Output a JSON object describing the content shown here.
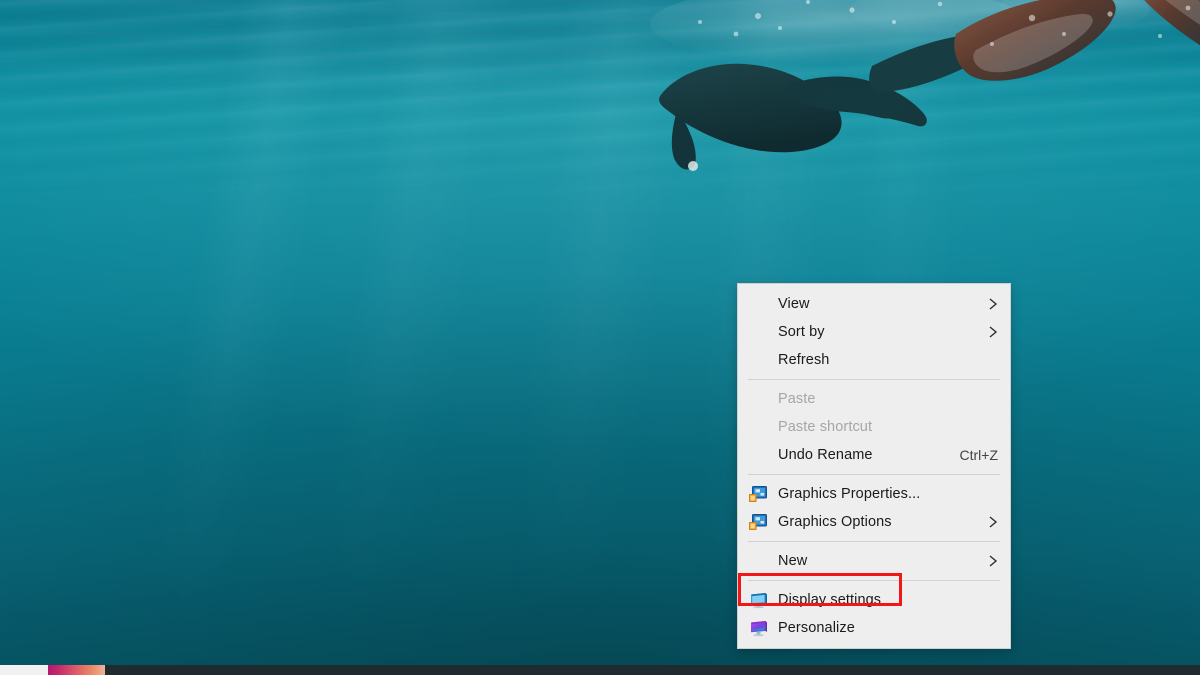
{
  "wallpaper": {
    "description": "underwater-scene-diver-with-fins",
    "water_color_top": "#0e93a4",
    "water_color_bottom": "#065968",
    "diver_color": "#173b3f"
  },
  "taskbar": {
    "background_color": "#1f2b2e",
    "search_box_color": "#f1f1f1",
    "thumbnail_gradient_start": "#b5186f",
    "thumbnail_gradient_end": "#efb39a"
  },
  "context_menu": {
    "background_color": "#eeeeee",
    "border_color": "#cfcfcf",
    "text_color": "#1b1b1b",
    "disabled_text_color": "#a6a6a6",
    "items": [
      {
        "label": "View",
        "icon": "none",
        "submenu": true,
        "disabled": false,
        "accel": ""
      },
      {
        "label": "Sort by",
        "icon": "none",
        "submenu": true,
        "disabled": false,
        "accel": ""
      },
      {
        "label": "Refresh",
        "icon": "none",
        "submenu": false,
        "disabled": false,
        "accel": ""
      },
      {
        "label": "Paste",
        "icon": "none",
        "submenu": false,
        "disabled": true,
        "accel": ""
      },
      {
        "label": "Paste shortcut",
        "icon": "none",
        "submenu": false,
        "disabled": true,
        "accel": ""
      },
      {
        "label": "Undo Rename",
        "icon": "none",
        "submenu": false,
        "disabled": false,
        "accel": "Ctrl+Z"
      },
      {
        "label": "Graphics Properties...",
        "icon": "graphics-monitor-icon",
        "submenu": false,
        "disabled": false,
        "accel": ""
      },
      {
        "label": "Graphics Options",
        "icon": "graphics-monitor-icon",
        "submenu": true,
        "disabled": false,
        "accel": ""
      },
      {
        "label": "New",
        "icon": "none",
        "submenu": true,
        "disabled": false,
        "accel": ""
      },
      {
        "label": "Display settings",
        "icon": "display-monitor-icon",
        "submenu": false,
        "disabled": false,
        "accel": ""
      },
      {
        "label": "Personalize",
        "icon": "personalize-monitor-icon",
        "submenu": false,
        "disabled": false,
        "accel": ""
      }
    ]
  },
  "highlight": {
    "target_label": "Display settings",
    "color": "#f21616",
    "border_width_px": 3
  }
}
